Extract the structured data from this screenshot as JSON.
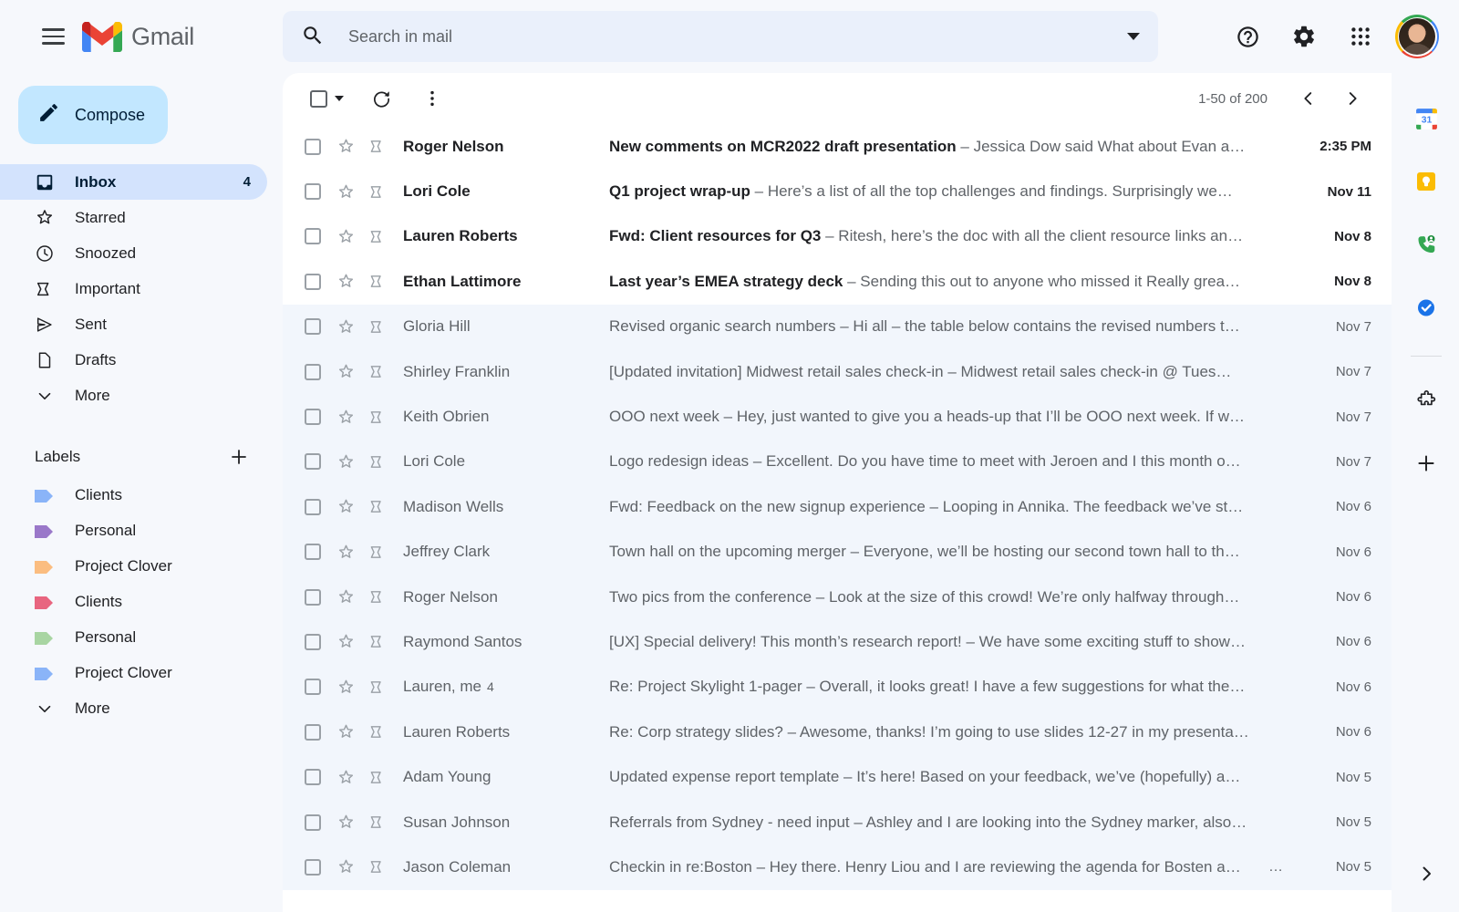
{
  "app": {
    "brand": "Gmail"
  },
  "header": {
    "menu_icon": "hamburger-icon",
    "search": {
      "placeholder": "Search in mail",
      "value": ""
    },
    "help_label": "Support",
    "settings_label": "Settings",
    "apps_label": "Google apps",
    "account_label": "Google Account"
  },
  "sidebar": {
    "compose_label": "Compose",
    "items": [
      {
        "label": "Inbox",
        "icon": "inbox-icon",
        "count": "4",
        "active": true
      },
      {
        "label": "Starred",
        "icon": "star-icon",
        "count": "",
        "active": false
      },
      {
        "label": "Snoozed",
        "icon": "clock-icon",
        "count": "",
        "active": false
      },
      {
        "label": "Important",
        "icon": "important-icon",
        "count": "",
        "active": false
      },
      {
        "label": "Sent",
        "icon": "send-icon",
        "count": "",
        "active": false
      },
      {
        "label": "Drafts",
        "icon": "draft-icon",
        "count": "",
        "active": false
      },
      {
        "label": "More",
        "icon": "chevron-down-icon",
        "count": "",
        "active": false
      }
    ],
    "labels_title": "Labels",
    "labels_add_label": "Create new label",
    "labels": [
      {
        "label": "Clients",
        "color": "#8ab4f8"
      },
      {
        "label": "Personal",
        "color": "#9a78c9"
      },
      {
        "label": "Project Clover",
        "color": "#fbbd80"
      },
      {
        "label": "Clients",
        "color": "#e8657f"
      },
      {
        "label": "Personal",
        "color": "#a8d5a2"
      },
      {
        "label": "Project Clover",
        "color": "#8ab4f8"
      }
    ],
    "labels_more_label": "More"
  },
  "toolbar": {
    "select_all_label": "Select",
    "refresh_label": "Refresh",
    "more_label": "More",
    "pagination": "1-50 of 200",
    "prev_label": "Newer",
    "next_label": "Older"
  },
  "emails": [
    {
      "sender": "Roger Nelson",
      "thread_count": "",
      "subject": "New comments on MCR2022 draft presentation",
      "snippet": "Jessica Dow said What about Evan a…",
      "date": "2:35 PM",
      "unread": true,
      "attachment": ""
    },
    {
      "sender": "Lori Cole",
      "thread_count": "",
      "subject": "Q1 project wrap-up",
      "snippet": "Here’s a list of all the top challenges and findings. Surprisingly we…",
      "date": "Nov 11",
      "unread": true,
      "attachment": ""
    },
    {
      "sender": "Lauren Roberts",
      "thread_count": "",
      "subject": "Fwd: Client resources for Q3",
      "snippet": "Ritesh, here’s the doc with all the client resource links an…",
      "date": "Nov 8",
      "unread": true,
      "attachment": ""
    },
    {
      "sender": "Ethan Lattimore",
      "thread_count": "",
      "subject": "Last year’s EMEA strategy deck",
      "snippet": "Sending this out to anyone who missed it Really grea…",
      "date": "Nov 8",
      "unread": true,
      "attachment": ""
    },
    {
      "sender": "Gloria Hill",
      "thread_count": "",
      "subject": "Revised organic search numbers",
      "snippet": "Hi all – the table below contains the revised numbers t…",
      "date": "Nov 7",
      "unread": false,
      "attachment": ""
    },
    {
      "sender": "Shirley Franklin",
      "thread_count": "",
      "subject": "[Updated invitation] Midwest retail sales check-in",
      "snippet": "Midwest retail sales check-in @ Tues…",
      "date": "Nov 7",
      "unread": false,
      "attachment": ""
    },
    {
      "sender": "Keith Obrien",
      "thread_count": "",
      "subject": "OOO next week",
      "snippet": "Hey, just wanted to give you a heads-up that I’ll be OOO next week. If w…",
      "date": "Nov 7",
      "unread": false,
      "attachment": ""
    },
    {
      "sender": "Lori Cole",
      "thread_count": "",
      "subject": "Logo redesign ideas",
      "snippet": "Excellent. Do you have time to meet with Jeroen and I this month o…",
      "date": "Nov 7",
      "unread": false,
      "attachment": ""
    },
    {
      "sender": "Madison Wells",
      "thread_count": "",
      "subject": "Fwd: Feedback on the new signup experience",
      "snippet": "Looping in Annika. The feedback we’ve st…",
      "date": "Nov 6",
      "unread": false,
      "attachment": ""
    },
    {
      "sender": "Jeffrey Clark",
      "thread_count": "",
      "subject": "Town hall on the upcoming merger",
      "snippet": "Everyone, we’ll be hosting our second town hall to th…",
      "date": "Nov 6",
      "unread": false,
      "attachment": ""
    },
    {
      "sender": "Roger Nelson",
      "thread_count": "",
      "subject": "Two pics from the conference",
      "snippet": "Look at the size of this crowd! We’re only halfway through…",
      "date": "Nov 6",
      "unread": false,
      "attachment": ""
    },
    {
      "sender": "Raymond Santos",
      "thread_count": "",
      "subject": "[UX] Special delivery! This month’s research report!",
      "snippet": "We have some exciting stuff to show…",
      "date": "Nov 6",
      "unread": false,
      "attachment": ""
    },
    {
      "sender": "Lauren, me",
      "thread_count": "4",
      "subject": "Re: Project Skylight 1-pager",
      "snippet": "Overall, it looks great! I have a few suggestions for what the…",
      "date": "Nov 6",
      "unread": false,
      "attachment": ""
    },
    {
      "sender": "Lauren Roberts",
      "thread_count": "",
      "subject": "Re: Corp strategy slides?",
      "snippet": "Awesome, thanks! I’m going to use slides 12-27 in my presenta…",
      "date": "Nov 6",
      "unread": false,
      "attachment": ""
    },
    {
      "sender": "Adam Young",
      "thread_count": "",
      "subject": "Updated expense report template",
      "snippet": "It’s here! Based on your feedback, we’ve (hopefully) a…",
      "date": "Nov 5",
      "unread": false,
      "attachment": ""
    },
    {
      "sender": "Susan Johnson",
      "thread_count": "",
      "subject": "Referrals from Sydney - need input",
      "snippet": "Ashley and I are looking into the Sydney marker, also…",
      "date": "Nov 5",
      "unread": false,
      "attachment": ""
    },
    {
      "sender": "Jason Coleman",
      "thread_count": "",
      "subject": "Checkin in re:Boston",
      "snippet": "Hey there. Henry Liou and I are reviewing the agenda for Bosten a…",
      "date": "Nov 5",
      "unread": false,
      "attachment": "…"
    }
  ],
  "rail": {
    "items": [
      {
        "name": "calendar-icon",
        "label": "Calendar"
      },
      {
        "name": "keep-icon",
        "label": "Keep"
      },
      {
        "name": "contacts-icon",
        "label": "Contacts"
      },
      {
        "name": "tasks-icon",
        "label": "Tasks"
      }
    ],
    "addons_label": "Get add-ons",
    "add_label": "Add",
    "expand_label": "Show side panel"
  },
  "separator": "–",
  "colors": {
    "page_bg": "#f6f8fc",
    "accent": "#c2e7ff",
    "active_nav": "#d3e3fd",
    "read_row": "#f2f6fc",
    "search_bg": "#eaf0fb"
  }
}
